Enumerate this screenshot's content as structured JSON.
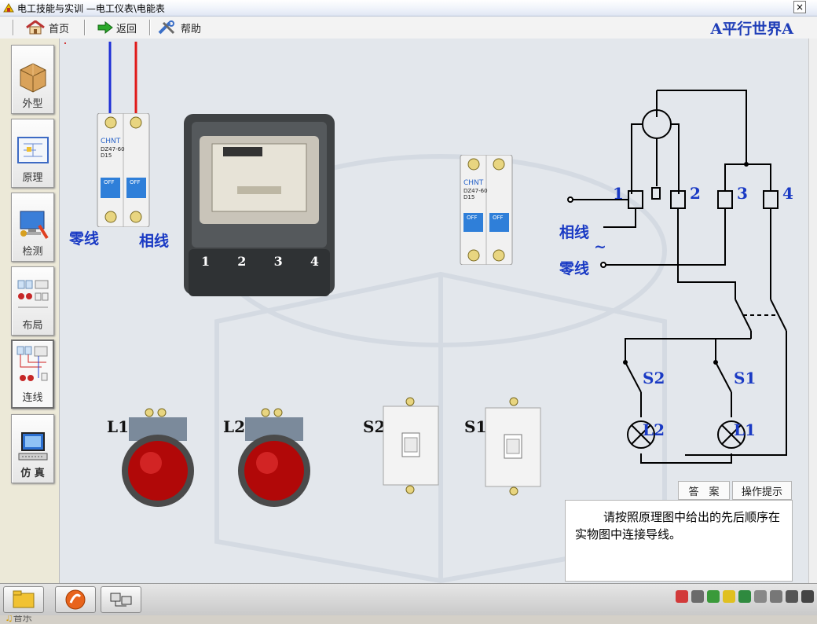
{
  "window": {
    "title": "电工技能与实训 —电工仪表\\电能表",
    "close_label": "×"
  },
  "toolbar": {
    "home_label": "首页",
    "back_label": "返回",
    "help_label": "帮助",
    "brand": "A平行世界A"
  },
  "sidebar": {
    "items": [
      {
        "label": "外型",
        "icon": "box-icon"
      },
      {
        "label": "原理",
        "icon": "schematic-icon"
      },
      {
        "label": "检测",
        "icon": "computer-tools-icon"
      },
      {
        "label": "布局",
        "icon": "layout-icon"
      },
      {
        "label": "连线",
        "icon": "wiring-icon"
      },
      {
        "label": "仿 真",
        "icon": "computer-icon"
      }
    ],
    "music_label": "音乐"
  },
  "workspace": {
    "neutral_label": "零线",
    "phase_label": "相线",
    "meter_terminals": [
      "1",
      "2",
      "3",
      "4"
    ],
    "lamps": [
      "L1",
      "L2"
    ],
    "switches": [
      "S2",
      "S1"
    ],
    "breaker_brand": "CHNT",
    "breaker_model": "DZ47-60",
    "breaker_rating": "D15",
    "breaker_off": "OFF"
  },
  "schematic": {
    "phase_label": "相线",
    "neutral_label": "零线",
    "ac_symbol": "~",
    "terminal_labels": [
      "1",
      "2",
      "3",
      "4"
    ],
    "switch_labels": [
      "S2",
      "S1"
    ],
    "lamp_labels": [
      "L2",
      "L1"
    ]
  },
  "actions": {
    "answer_label": "答　案",
    "tips_label": "操作提示"
  },
  "hint": {
    "text": "请按照原理图中给出的先后顺序在实物图中连接导线。"
  },
  "colors": {
    "accent": "#1a3ac4",
    "phase_wire": "#e01818",
    "neutral_wire": "#1d2fd6"
  }
}
